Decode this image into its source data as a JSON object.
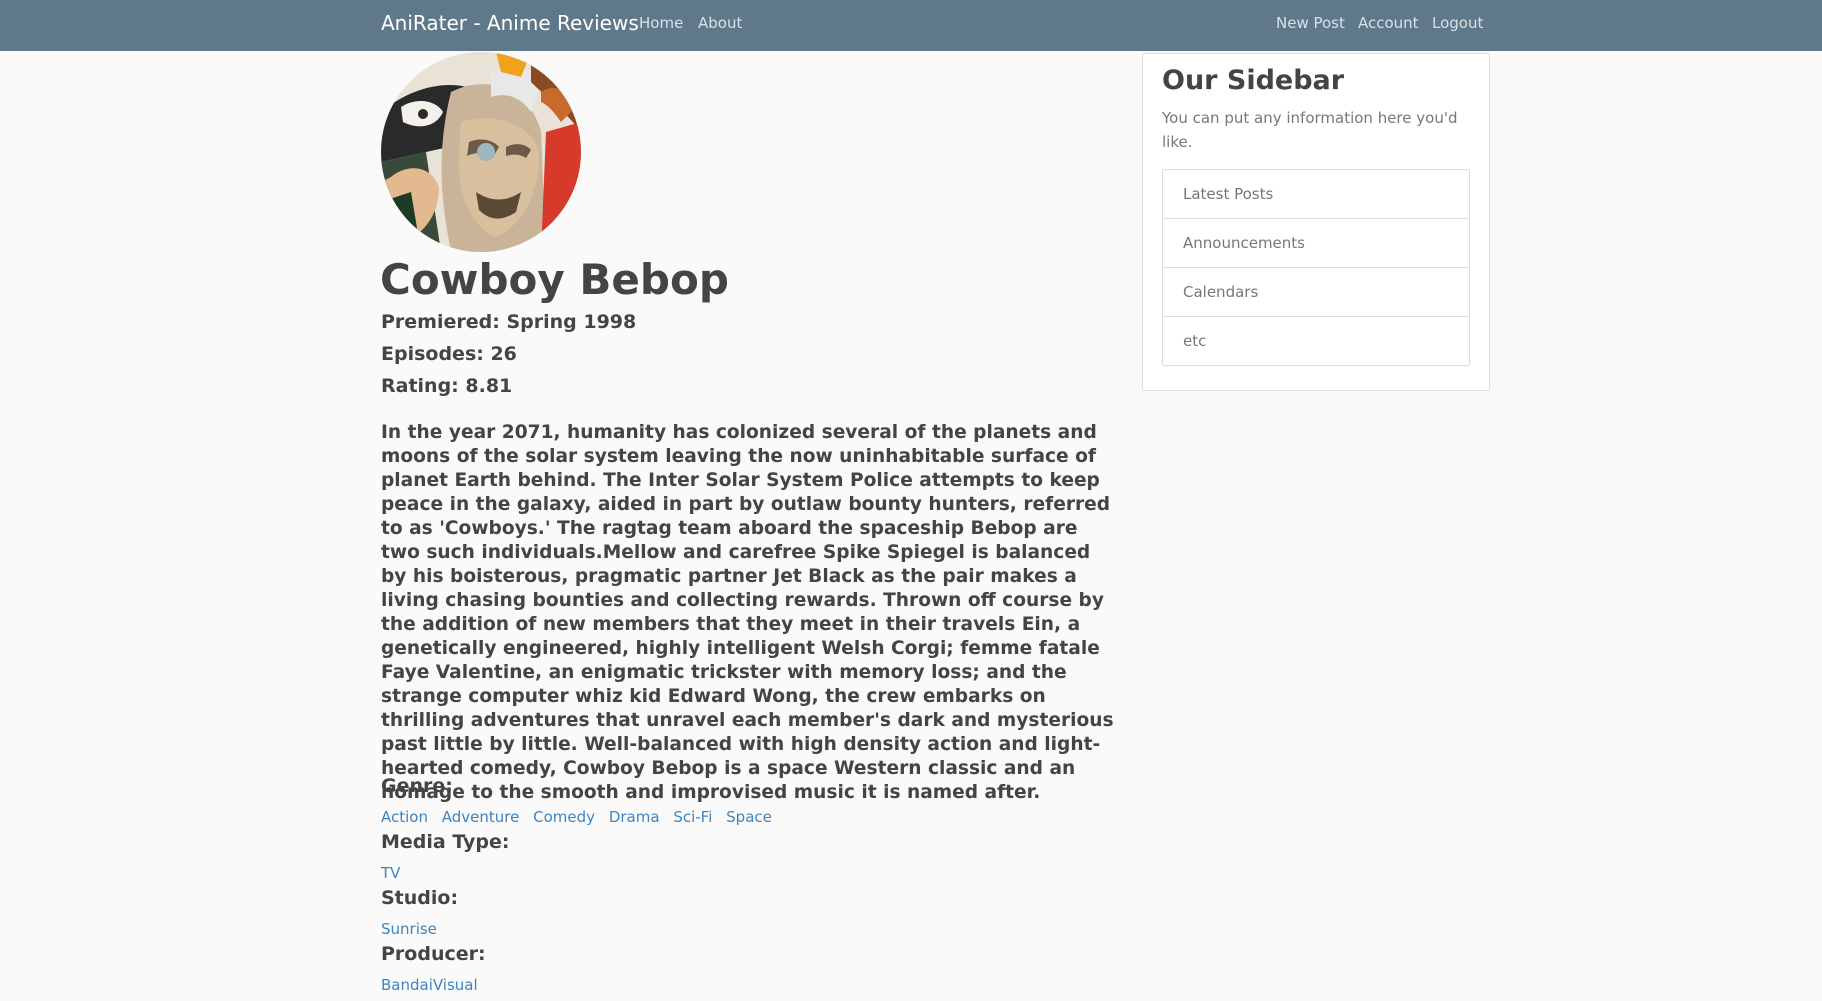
{
  "navbar": {
    "brand": "AniRater - Anime Reviews",
    "left_links": [
      "Home",
      "About"
    ],
    "right_links": [
      "New Post",
      "Account",
      "Logout"
    ],
    "background_color": "#5f788a"
  },
  "anime": {
    "image_alt": "Cowboy Bebop cover art",
    "title": "Cowboy Bebop",
    "premiered": "Premiered: Spring 1998",
    "episodes": "Episodes: 26",
    "rating": "Rating: 8.81",
    "synopsis": "In the year 2071, humanity has colonized several of the planets and moons of the solar system leaving the now uninhabitable surface of planet Earth behind. The Inter Solar System Police attempts to keep peace in the galaxy, aided in part by outlaw bounty hunters, referred to as 'Cowboys.' The ragtag team aboard the spaceship Bebop are two such individuals.Mellow and carefree Spike Spiegel is balanced by his boisterous, pragmatic partner Jet Black as the pair makes a living chasing bounties and collecting rewards. Thrown off course by the addition of new members that they meet in their travels Ein, a genetically engineered, highly intelligent Welsh Corgi; femme fatale Faye Valentine, an enigmatic trickster with memory loss; and the strange computer whiz kid Edward Wong, the crew embarks on thrilling adventures that unravel each member's dark and mysterious past little by little. Well-balanced with high density action and light-hearted comedy, Cowboy Bebop is a space Western classic and an homage to the smooth and improvised music it is named after.",
    "genre_label": "Genre:",
    "genres": [
      "Action",
      "Adventure",
      "Comedy",
      "Drama",
      "Sci-Fi",
      "Space"
    ],
    "media_type_label": "Media Type:",
    "media_types": [
      "TV"
    ],
    "studio_label": "Studio:",
    "studios": [
      "Sunrise"
    ],
    "producer_label": "Producer:",
    "producers": [
      "BandaiVisual"
    ],
    "link_color": "#3d84c2"
  },
  "sidebar": {
    "title": "Our Sidebar",
    "text": "You can put any information here you'd like.",
    "items": [
      "Latest Posts",
      "Announcements",
      "Calendars",
      "etc"
    ]
  }
}
